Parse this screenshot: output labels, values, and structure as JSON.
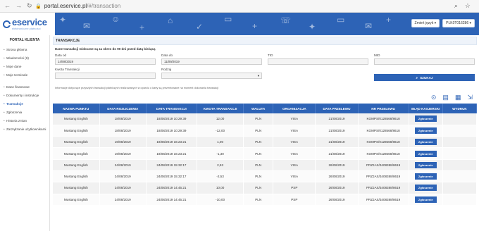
{
  "browser": {
    "back": "←",
    "forward": "→",
    "reload": "↻",
    "url_host": "portal.eservice.pl",
    "url_path": "/#/transaction"
  },
  "header": {
    "brand": "eservice",
    "brand_sub": "elektroniczne płatności",
    "language_label": "Zmień język ▾",
    "account_label": "PLK0T016286 ▾"
  },
  "sidebar": {
    "title": "PORTAL KLIENTA",
    "items": [
      {
        "label": "Strona główna"
      },
      {
        "label": "Wiadomości (8)"
      },
      {
        "label": "Moje dane"
      },
      {
        "label": "Moje terminale"
      },
      {
        "label": "Dane finansowe"
      },
      {
        "label": "Dokumenty i instrukcje"
      },
      {
        "label": "Transakcje"
      },
      {
        "label": "Zgłoszenia"
      },
      {
        "label": "Historia zmian"
      },
      {
        "label": "Zarządzanie użytkownikami"
      }
    ]
  },
  "page": {
    "section_title": "TRANSAKCJE",
    "notice": "Dane transakcji widoczne są za okres do 90 dni przed datą bieżącą",
    "filters": {
      "date_from_label": "Data od",
      "date_from_value": "14/08/2019",
      "date_to_label": "Data do",
      "date_to_value": "11/09/2019",
      "tid_label": "TID",
      "tid_value": "",
      "mid_label": "MID",
      "mid_value": "",
      "amount_label": "Kwota Transakcji",
      "amount_value": "",
      "type_label": "Rodzaj",
      "type_value": "",
      "search_label": "SZUKAJ"
    },
    "info": "Informacje dotyczące przyszłych transakcji płatniczych realizowanych w oparciu o karty są prezentowane na moment dokonania transakcji"
  },
  "table": {
    "columns": [
      "NAZWA PUNKTU",
      "DATA ROZLICZENIA",
      "DATA TRANSAKCJI",
      "KWOTA TRANSAKCJI",
      "WALUTA",
      "ORGANIZACJA",
      "DATA PRZELEWU",
      "NR PRZELEWU",
      "BŁĄD KASJERSKI",
      "WYDRUK"
    ],
    "report_label": "Zgłoszenie",
    "rows": [
      [
        "Mustang English",
        "18/08/2019",
        "18/08/2019 10:29:39",
        "12,00",
        "PLN",
        "VISA",
        "21/08/2019",
        "KOMPS/0128568/8618"
      ],
      [
        "Mustang English",
        "18/08/2019",
        "18/08/2019 10:29:39",
        "-12,00",
        "PLN",
        "VISA",
        "21/08/2019",
        "KOMPS/0128568/8618"
      ],
      [
        "Mustang English",
        "19/08/2019",
        "19/08/2019 16:23:21",
        "1,00",
        "PLN",
        "VISA",
        "21/08/2019",
        "KOMPS/0128568/8618"
      ],
      [
        "Mustang English",
        "19/08/2019",
        "19/08/2019 16:23:21",
        "-1,30",
        "PLN",
        "VISA",
        "21/08/2019",
        "KOMPS/0128568/8618"
      ],
      [
        "Mustang English",
        "24/08/2019",
        "24/08/2019 15:32:17",
        "2,53",
        "PLN",
        "VISA",
        "26/08/2019",
        "PRZJAS/3408388/8619"
      ],
      [
        "Mustang English",
        "24/08/2019",
        "24/08/2019 15:32:17",
        "-2,53",
        "PLN",
        "VISA",
        "26/08/2019",
        "PRZJAS/3408388/8619"
      ],
      [
        "Mustang English",
        "24/08/2019",
        "24/08/2019 14:45:21",
        "10,00",
        "PLN",
        "PSP",
        "26/08/2019",
        "PRZJAS/3408388/8619"
      ],
      [
        "Mustang English",
        "24/08/2019",
        "24/08/2019 14:45:21",
        "-10,00",
        "PLN",
        "PSP",
        "26/08/2019",
        "PRZJAS/3408388/8619"
      ]
    ]
  },
  "colors": {
    "brand": "#2d63b6",
    "header_bg": "#2d63b6"
  },
  "icons": [
    "back-icon",
    "forward-icon",
    "reload-icon",
    "lock-icon",
    "search-icon",
    "star-icon",
    "print-icon",
    "excel-icon",
    "grid-icon",
    "export-icon"
  ]
}
